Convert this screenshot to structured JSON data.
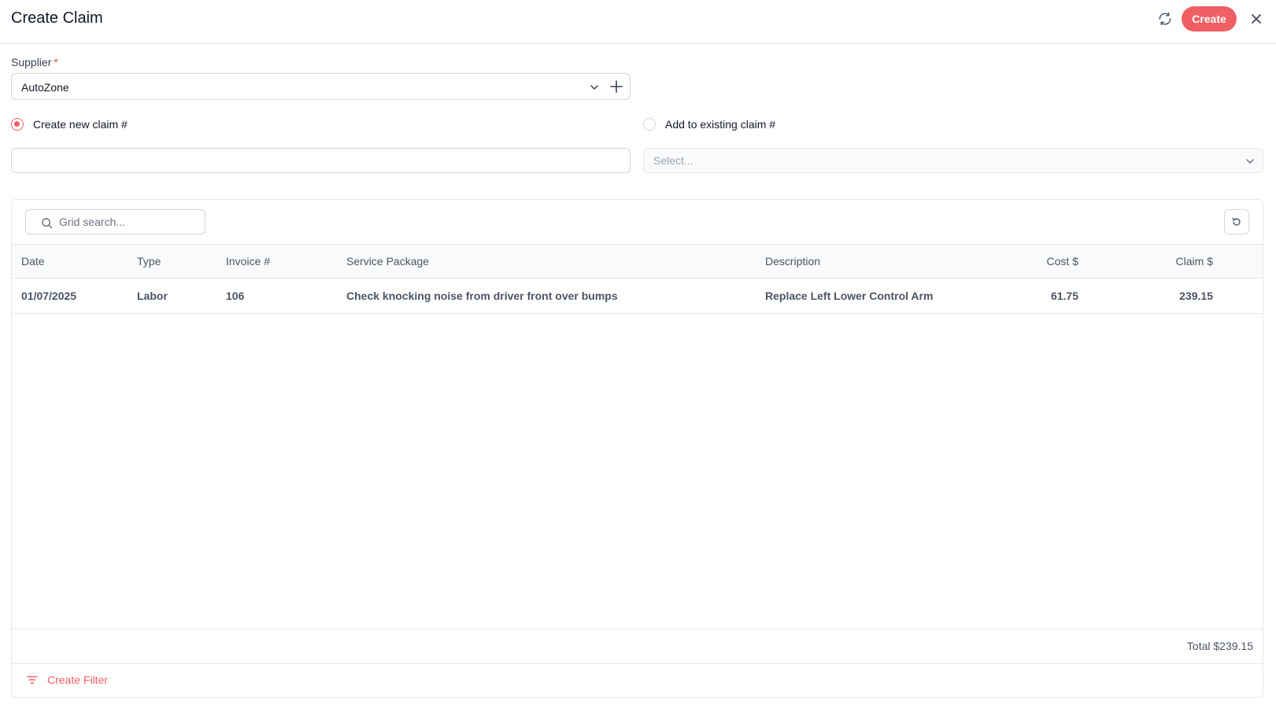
{
  "header": {
    "title": "Create Claim",
    "create_label": "Create"
  },
  "form": {
    "supplier_label": "Supplier",
    "required_mark": "*",
    "supplier_value": "AutoZone",
    "option_new_label": "Create new claim #",
    "option_existing_label": "Add to existing claim #",
    "selected_option": "new",
    "new_claim_value": "",
    "existing_placeholder": "Select..."
  },
  "grid": {
    "search_placeholder": "Grid search...",
    "columns": [
      "Date",
      "Type",
      "Invoice #",
      "Service Package",
      "Description",
      "Cost $",
      "Claim $"
    ],
    "rows": [
      {
        "date": "01/07/2025",
        "type": "Labor",
        "invoice": "106",
        "service_package": "Check knocking noise from driver front over bumps",
        "description": "Replace Left Lower Control Arm",
        "cost": "61.75",
        "claim": "239.15"
      }
    ],
    "total": "Total $239.15",
    "create_filter_label": "Create Filter"
  },
  "icons": {
    "refresh": "refresh-icon",
    "close": "close-icon",
    "chevron": "chevron-down-icon",
    "add": "plus-icon",
    "search": "search-icon",
    "reset": "undo-icon",
    "filter": "filter-icon"
  },
  "colors": {
    "accent": "#ef5f63",
    "border": "#e5e7eb",
    "header_bg": "#f9fafb"
  }
}
